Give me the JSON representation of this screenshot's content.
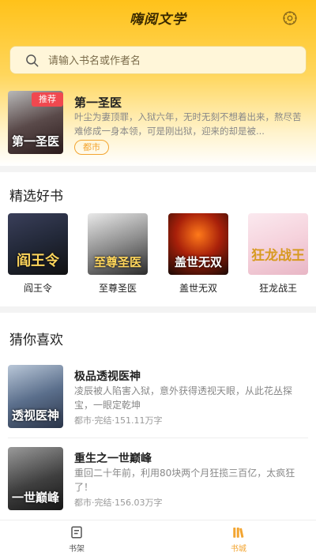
{
  "header": {
    "title": "嗨阅文学",
    "settings_icon": "gear-icon"
  },
  "search": {
    "placeholder": "请输入书名或作者名",
    "icon": "search-icon"
  },
  "recommend": {
    "tag": "推荐",
    "cover_text": "第一圣医",
    "title": "第一圣医",
    "desc": "叶尘为妻顶罪，入狱六年，无时无刻不想着出来，熬尽苦难修成一身本领，可是刚出狱，迎来的却是被...",
    "genre": "都市"
  },
  "featured": {
    "title": "精选好书",
    "books": [
      {
        "cover_text": "阎王令",
        "name": "阎王令"
      },
      {
        "cover_text": "至尊圣医",
        "name": "至尊圣医"
      },
      {
        "cover_text": "盖世无双",
        "name": "盖世无双"
      },
      {
        "cover_text": "狂龙战王",
        "name": "狂龙战王"
      }
    ]
  },
  "guess": {
    "title": "猜你喜欢",
    "items": [
      {
        "cover_text": "透视医神",
        "title": "极品透视医神",
        "desc": "凌辰被人陷害入狱，意外获得透视天眼，从此花丛探宝，一眼定乾坤",
        "meta": "都市·完结·151.11万字"
      },
      {
        "cover_text": "一世巅峰",
        "title": "重生之一世巅峰",
        "desc": "重回二十年前，利用80块两个月狂揽三百亿，太疯狂了！",
        "meta": "都市·完结·156.03万字"
      }
    ]
  },
  "tabbar": {
    "tabs": [
      {
        "label": "书架",
        "icon": "bookshelf-icon",
        "active": false
      },
      {
        "label": "书城",
        "icon": "bookstore-icon",
        "active": true
      }
    ],
    "active_color": "#f3a531",
    "inactive_color": "#555555"
  },
  "colors": {
    "accent": "#ffc21a",
    "tag_red": "#f0484f",
    "genre_orange": "#f3a531"
  }
}
